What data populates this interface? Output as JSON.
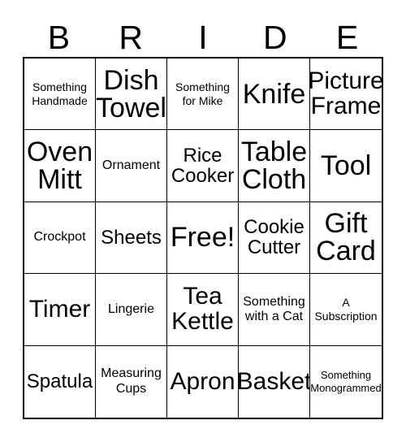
{
  "card": {
    "title": "BRIDE Bingo Card",
    "header_letters": [
      "B",
      "R",
      "I",
      "D",
      "E"
    ],
    "background_color": "#ffffff",
    "line_color": "#000000",
    "text_color": "#000000",
    "columns": 5,
    "rows": 5,
    "free_space_index": 12,
    "cells": [
      {
        "text": "Something\nHandmade",
        "size": "s"
      },
      {
        "text": "Dish\nTowel",
        "size": "hg"
      },
      {
        "text": "Something\nfor Mike",
        "size": "s"
      },
      {
        "text": "Knife",
        "size": "hg"
      },
      {
        "text": "Picture\nFrame",
        "size": "xxl"
      },
      {
        "text": "Oven\nMitt",
        "size": "hg"
      },
      {
        "text": "Ornament",
        "size": "m"
      },
      {
        "text": "Rice\nCooker",
        "size": "xl"
      },
      {
        "text": "Table\nCloth",
        "size": "hg"
      },
      {
        "text": "Tool",
        "size": "hg"
      },
      {
        "text": "Crockpot",
        "size": "m"
      },
      {
        "text": "Sheets",
        "size": "xl"
      },
      {
        "text": "Free!",
        "size": "hg"
      },
      {
        "text": "Cookie\nCutter",
        "size": "xl"
      },
      {
        "text": "Gift\nCard",
        "size": "hg"
      },
      {
        "text": "Timer",
        "size": "xxl"
      },
      {
        "text": "Lingerie",
        "size": "m"
      },
      {
        "text": "Tea\nKettle",
        "size": "xxl"
      },
      {
        "text": "Something\nwith a Cat",
        "size": "m"
      },
      {
        "text": "A\nSubscription",
        "size": "s"
      },
      {
        "text": "Spatula",
        "size": "xl"
      },
      {
        "text": "Measuring\nCups",
        "size": "m"
      },
      {
        "text": "Apron",
        "size": "xxl"
      },
      {
        "text": "Basket",
        "size": "xxl"
      },
      {
        "text": "Something\nMonogrammed",
        "size": "xs"
      }
    ]
  }
}
